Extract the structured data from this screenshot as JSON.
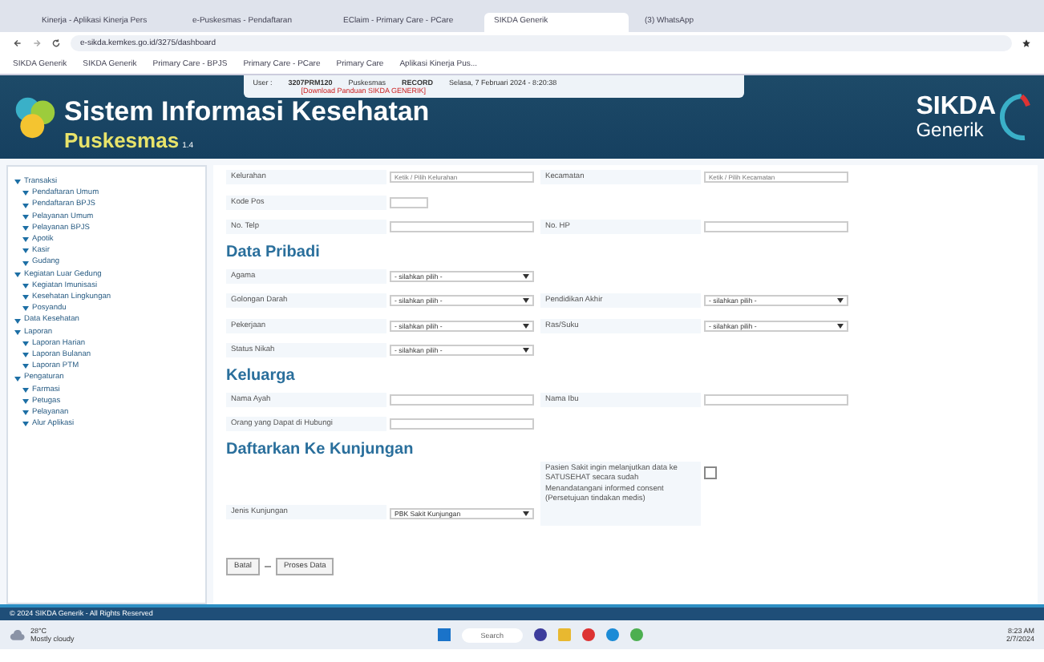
{
  "browser": {
    "tabs": [
      {
        "label": "Kinerja - Aplikasi Kinerja Pers",
        "selected": false
      },
      {
        "label": "e-Puskesmas - Pendaftaran",
        "selected": false
      },
      {
        "label": "EClaim - Primary Care - PCare",
        "selected": false
      },
      {
        "label": "SIKDA Generik",
        "selected": true
      },
      {
        "label": "(3) WhatsApp",
        "selected": false
      }
    ],
    "url": "e-sikda.kemkes.go.id/3275/dashboard",
    "bookmarks": [
      "SIKDA Generik",
      "SIKDA Generik",
      "Primary Care - BPJS",
      "Primary Care - PCare",
      "Primary Care",
      "Aplikasi Kinerja Pus..."
    ]
  },
  "header": {
    "title": "Sistem Informasi Kesehatan",
    "subtitle": "Puskesmas",
    "version": "1.4",
    "user_label": "User :",
    "user": "3207PRM120",
    "unit_label": "Puskesmas",
    "download": "[Download Panduan SIKDA GENERIK]",
    "status": "RECORD",
    "date": "Selasa, 7 Februari 2024 - 8:20:38",
    "brand": "SIKDA",
    "brand_sub": "Generik"
  },
  "sidebar": {
    "items": [
      {
        "label": "Transaksi",
        "children": [
          {
            "label": "Pendaftaran Umum"
          },
          {
            "label": "Pendaftaran BPJS"
          },
          {
            "label": "Pelayanan Umum"
          },
          {
            "label": "Pelayanan BPJS"
          },
          {
            "label": "Apotik"
          },
          {
            "label": "Kasir"
          },
          {
            "label": "Gudang"
          }
        ]
      },
      {
        "label": "Kegiatan Luar Gedung",
        "children": [
          {
            "label": "Kegiatan Imunisasi"
          },
          {
            "label": "Kesehatan Lingkungan"
          },
          {
            "label": "Posyandu"
          }
        ]
      },
      {
        "label": "Data Kesehatan"
      },
      {
        "label": "Laporan",
        "children": [
          {
            "label": "Laporan Harian"
          },
          {
            "label": "Laporan Bulanan"
          },
          {
            "label": "Laporan PTM"
          }
        ]
      },
      {
        "label": "Pengaturan",
        "children": [
          {
            "label": "Farmasi"
          },
          {
            "label": "Petugas"
          },
          {
            "label": "Pelayanan"
          },
          {
            "label": "Alur Aplikasi"
          }
        ]
      }
    ]
  },
  "form": {
    "rows": [
      {
        "kind": "fields",
        "fields": [
          {
            "label": "Kelurahan",
            "kind": "input",
            "placeholder": "Ketik / Pilih Kelurahan"
          },
          {
            "label": "Kecamatan",
            "kind": "input",
            "placeholder": "Ketik / Pilih Kecamatan"
          }
        ]
      },
      {
        "kind": "fields",
        "fields": [
          {
            "label": "Kode Pos",
            "kind": "short"
          }
        ]
      },
      {
        "kind": "fields",
        "fields": [
          {
            "label": "No. Telp",
            "kind": "input"
          },
          {
            "label": "No. HP",
            "kind": "input"
          }
        ]
      },
      {
        "kind": "heading",
        "label": "Data Pribadi"
      },
      {
        "kind": "fields",
        "fields": [
          {
            "label": "Agama",
            "kind": "select",
            "value": "- silahkan pilih -"
          }
        ]
      },
      {
        "kind": "fields",
        "fields": [
          {
            "label": "Golongan Darah",
            "kind": "select",
            "value": "- silahkan pilih -"
          },
          {
            "label": "Pendidikan Akhir",
            "kind": "select",
            "value": "- silahkan pilih -"
          }
        ]
      },
      {
        "kind": "fields",
        "fields": [
          {
            "label": "Pekerjaan",
            "kind": "select",
            "value": "- silahkan pilih -"
          },
          {
            "label": "Ras/Suku",
            "kind": "select",
            "value": "- silahkan pilih -"
          }
        ]
      },
      {
        "kind": "fields",
        "fields": [
          {
            "label": "Status Nikah",
            "kind": "select",
            "value": "- silahkan pilih -"
          }
        ]
      },
      {
        "kind": "heading",
        "label": "Keluarga"
      },
      {
        "kind": "fields",
        "fields": [
          {
            "label": "Nama Ayah",
            "kind": "input"
          },
          {
            "label": "Nama Ibu",
            "kind": "input"
          }
        ]
      },
      {
        "kind": "fields",
        "fields": [
          {
            "label": "Orang yang Dapat di Hubungi",
            "kind": "input"
          }
        ]
      },
      {
        "kind": "heading",
        "label": "Daftarkan Ke Kunjungan"
      },
      {
        "kind": "consent",
        "label": "Jenis Kunjungan",
        "value": "PBK Sakit Kunjungan",
        "text": "Pasien Sakit ingin melanjutkan data ke SATUSEHAT secara sudah Menandatangani informed consent (Persetujuan tindakan medis)",
        "checked": false
      }
    ],
    "buttons": [
      "Batal",
      "Proses Data"
    ]
  },
  "footer": "© 2024 SIKDA Generik - All Rights Reserved",
  "taskbar": {
    "weather": "28°C",
    "weather_sub": "Mostly cloudy",
    "search": "Search",
    "time": "8:23 AM",
    "date": "2/7/2024"
  }
}
